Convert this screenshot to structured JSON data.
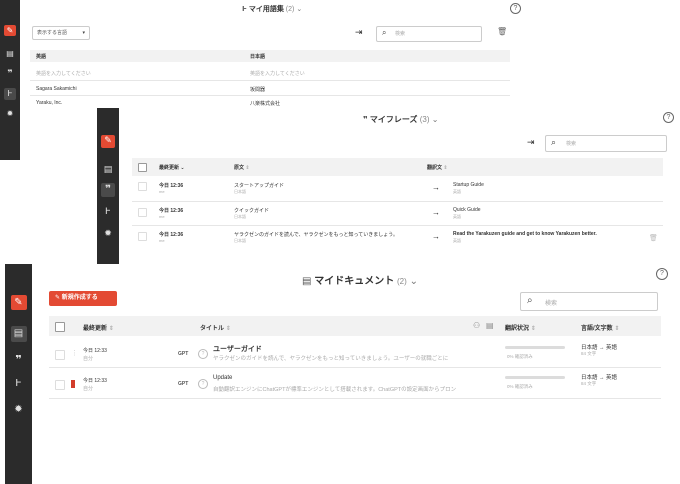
{
  "sidebar_icons": {
    "edit": "pencil-icon",
    "document": "document-icon",
    "quote": "quote-icon",
    "glossary": "glossary-icon",
    "settings": "gear-icon"
  },
  "glossary": {
    "title": "マイ用語集",
    "count": "(2)",
    "filter_select": "表示する言語",
    "search_placeholder": "検索",
    "columns": [
      "英語",
      "日本語"
    ],
    "input_placeholder_left": "英語を入力してください",
    "input_placeholder_right": "英語を入力してください",
    "rows": [
      {
        "source": "Sagara Sakamichi",
        "target": "坂間器"
      },
      {
        "source": "Yaraku, Inc.",
        "target": "八楽株式会社"
      }
    ]
  },
  "phrases": {
    "title": "マイフレーズ",
    "count": "(3)",
    "search_placeholder": "検索",
    "columns": [
      "最終更新",
      "原文",
      "翻訳文"
    ],
    "rows": [
      {
        "updated": "今日 12:36",
        "user": "me",
        "source": "スタートアップガイド",
        "source_lang": "日本語",
        "target": "Startup Guide",
        "target_lang": "英語"
      },
      {
        "updated": "今日 12:36",
        "user": "me",
        "source": "クイックガイド",
        "source_lang": "日本語",
        "target": "Quick Guide",
        "target_lang": "英語"
      },
      {
        "updated": "今日 12:36",
        "user": "me",
        "source": "ヤラクゼンのガイドを読んで、ヤラクゼンをもっと知っていきましょう。",
        "source_lang": "日本語",
        "target": "Read the Yarakuzen guide and get to know Yarakuzen better.",
        "target_lang": "英語"
      }
    ]
  },
  "documents": {
    "title": "マイドキュメント",
    "count": "(2)",
    "new_button": "新規作成する",
    "search_placeholder": "検索",
    "columns": [
      "最終更新",
      "タイトル",
      "翻訳状況",
      "言語/文字数"
    ],
    "rows": [
      {
        "updated": "今日 12:33",
        "user": "自分",
        "engine": "GPT",
        "title": "ユーザーガイド",
        "snippet": "ヤラクゼンのガイドを読んで、ヤラクゼンをもっと知っていきましょう。ユーザーの就職ごとに",
        "progress_label": "0% 確認済み",
        "progress": 0,
        "langs": "日本語 → 英語",
        "chars": "84 文字",
        "bookmarked": false
      },
      {
        "updated": "今日 12:33",
        "user": "自分",
        "engine": "GPT",
        "title": "Update",
        "snippet": "自動翻訳エンジンにChatGPTが標準エンジンとして搭載されます。ChatGPTの設定画面からプロン",
        "progress_label": "0% 確認済み",
        "progress": 0,
        "langs": "日本語 → 英語",
        "chars": "84 文字",
        "bookmarked": true
      }
    ]
  },
  "colors": {
    "accent": "#e34a33",
    "sidebar": "#2b2b2b"
  }
}
